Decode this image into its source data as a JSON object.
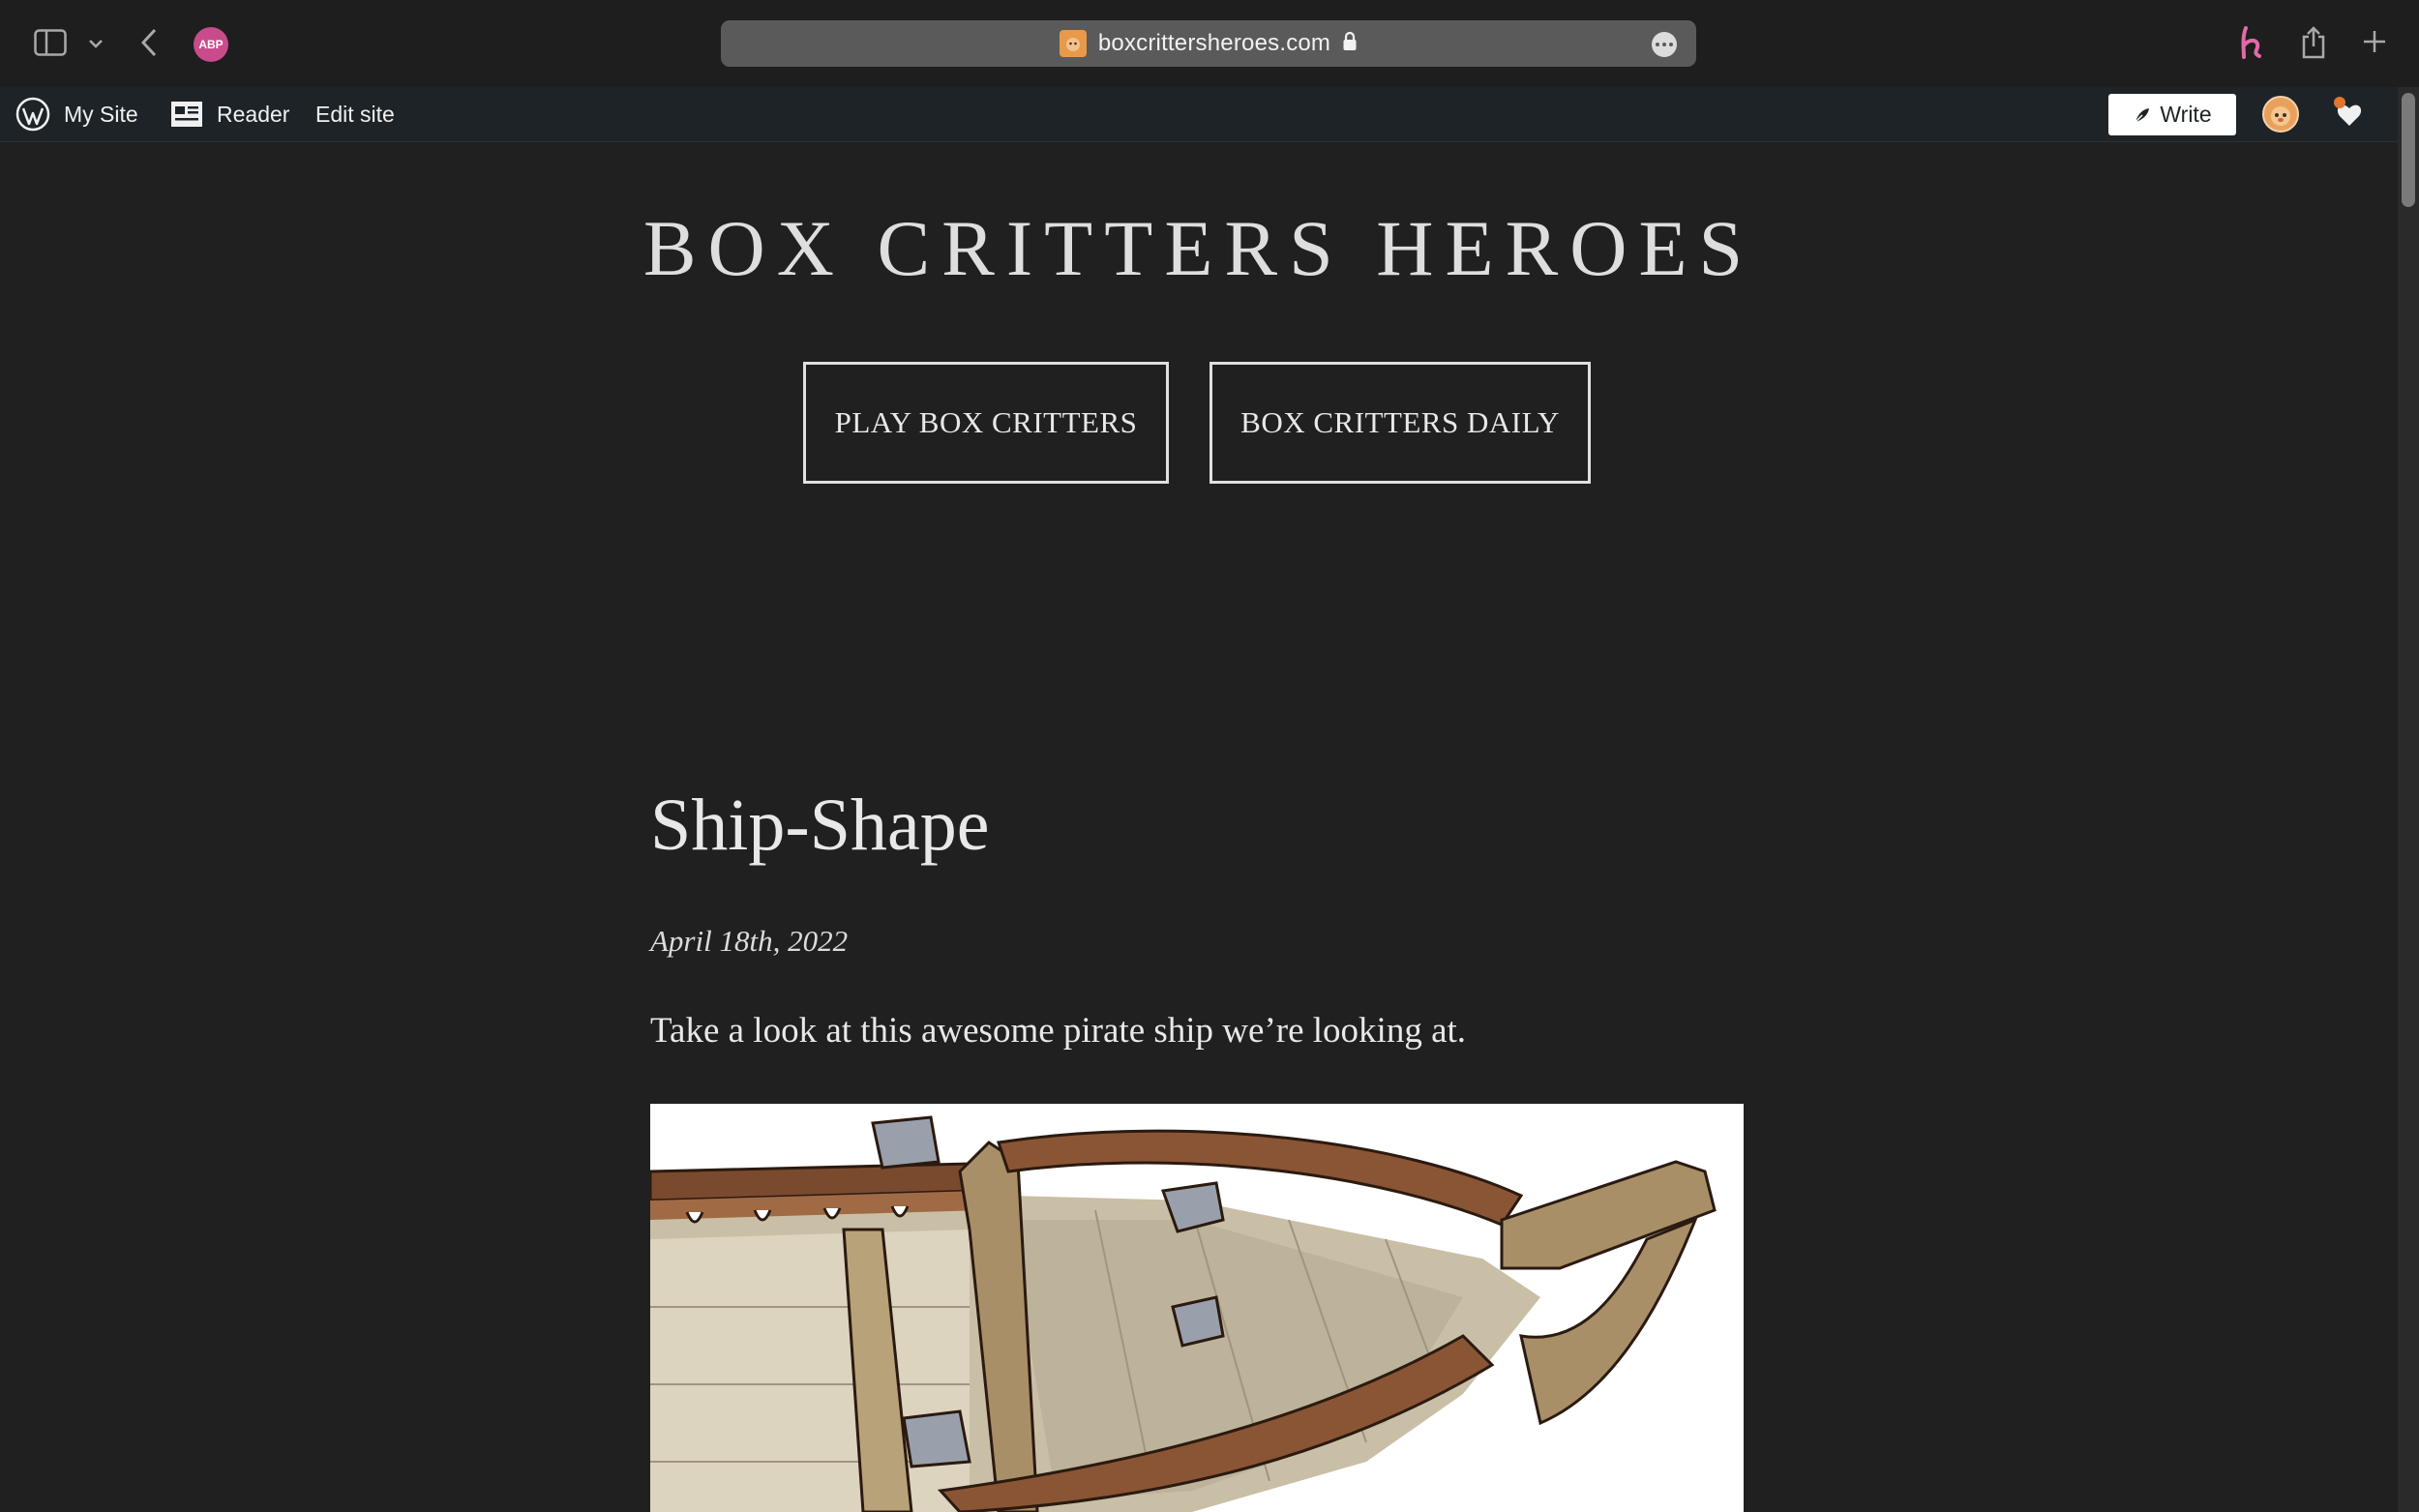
{
  "browser": {
    "url": "boxcrittersheroes.com",
    "abp_label": "ABP"
  },
  "adminbar": {
    "my_site": "My Site",
    "reader": "Reader",
    "edit_site": "Edit site",
    "write": "Write"
  },
  "site": {
    "title": "BOX CRITTERS HEROES",
    "nav": [
      "PLAY BOX CRITTERS",
      "BOX CRITTERS DAILY"
    ]
  },
  "post": {
    "title": "Ship-Shape",
    "date": "April 18th, 2022",
    "body": "Take a look at this awesome pirate ship we’re looking at."
  },
  "colors": {
    "background": "#202020",
    "adminbar": "#1d2327",
    "abp": "#c84c8c",
    "honey": "#e06aa8"
  },
  "icons": [
    "sidebar-icon",
    "chevron-down-icon",
    "back-icon",
    "lock-icon",
    "honey-icon",
    "share-icon",
    "new-tab-icon",
    "wordpress-icon",
    "reader-icon",
    "pen-icon",
    "bell-icon"
  ]
}
